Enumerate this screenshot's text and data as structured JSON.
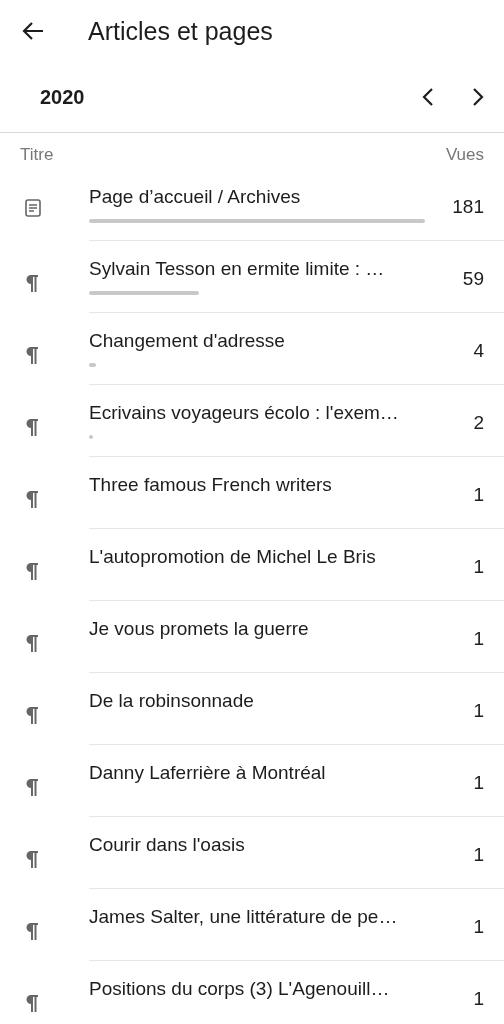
{
  "header": {
    "title": "Articles et pages"
  },
  "period": {
    "label": "2020"
  },
  "table": {
    "columns": [
      "Titre",
      "Vues"
    ],
    "rows": [
      {
        "kind": "page",
        "title": "Page d’accueil / Archives",
        "views": "181"
      },
      {
        "kind": "post",
        "title": "Sylvain Tesson en ermite limite : …",
        "views": "59"
      },
      {
        "kind": "post",
        "title": "Changement d'adresse",
        "views": "4"
      },
      {
        "kind": "post",
        "title": "Ecrivains voyageurs écolo : l'exem…",
        "views": "2"
      },
      {
        "kind": "post",
        "title": "Three famous French writers",
        "views": "1"
      },
      {
        "kind": "post",
        "title": "L'autopromotion de Michel Le Bris",
        "views": "1"
      },
      {
        "kind": "post",
        "title": "Je vous promets la guerre",
        "views": "1"
      },
      {
        "kind": "post",
        "title": "De la robinsonnade",
        "views": "1"
      },
      {
        "kind": "post",
        "title": "Danny Laferrière à Montréal",
        "views": "1"
      },
      {
        "kind": "post",
        "title": "Courir dans l'oasis",
        "views": "1"
      },
      {
        "kind": "post",
        "title": "James Salter, une littérature de pe…",
        "views": "1"
      },
      {
        "kind": "post",
        "title": "Positions du corps (3) L'Agenouill…",
        "views": "1"
      }
    ]
  }
}
